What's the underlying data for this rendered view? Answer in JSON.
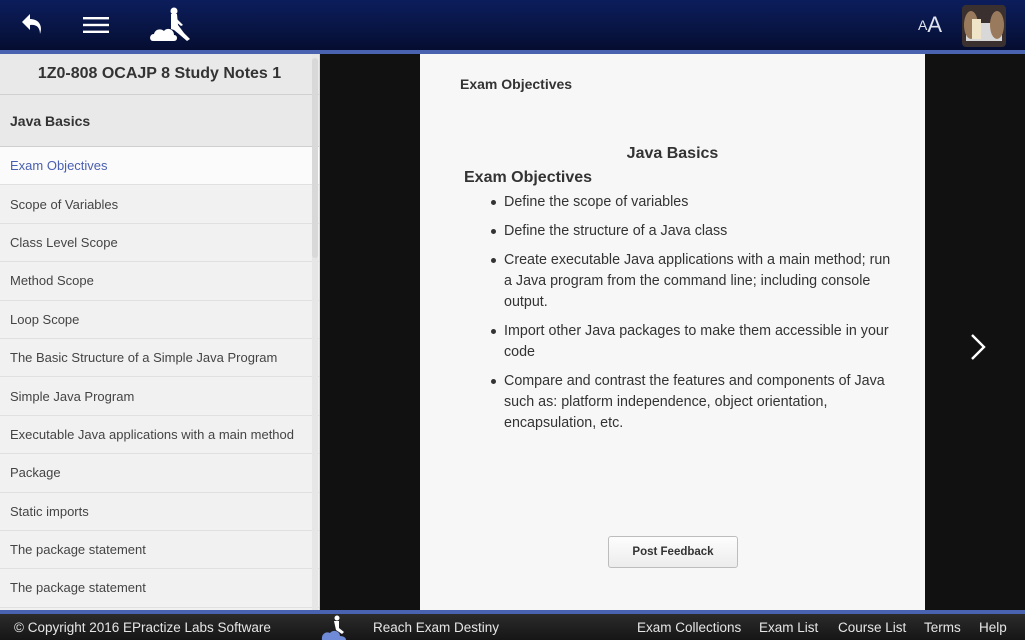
{
  "header": {
    "back_icon": "back-arrow-icon",
    "menu_icon": "hamburger-menu-icon",
    "logo_icon": "person-reading-on-cloud-logo",
    "font_size_small": "A",
    "font_size_large": "A",
    "avatar": "user-avatar-photo"
  },
  "sidebar": {
    "title": "1Z0-808 OCAJP 8 Study Notes 1",
    "section": "Java Basics",
    "items": [
      {
        "label": "Exam Objectives",
        "active": true
      },
      {
        "label": "Scope of Variables"
      },
      {
        "label": "Class Level Scope"
      },
      {
        "label": "Method Scope"
      },
      {
        "label": "Loop Scope"
      },
      {
        "label": "The Basic Structure of a Simple Java Program"
      },
      {
        "label": "Simple Java Program"
      },
      {
        "label": "Executable Java applications with a main method"
      },
      {
        "label": "Package"
      },
      {
        "label": "Static imports"
      },
      {
        "label": "The package statement"
      },
      {
        "label": "The package statement"
      }
    ]
  },
  "content": {
    "heading": "Exam Objectives",
    "doc_title": "Java Basics",
    "doc_subtitle": "Exam Objectives",
    "objectives": [
      "Define the scope of variables",
      "Define the structure of a Java class",
      "Create executable Java applications with a main method; run a Java program from the command line; including console output.",
      "Import other Java packages to make them accessible in your code",
      "Compare and contrast the features and components of Java such as: platform independence, object orientation, encapsulation, etc."
    ],
    "feedback_button": "Post Feedback",
    "next_icon": "chevron-right-icon"
  },
  "footer": {
    "copyright": "© Copyright 2016 EPractize Labs Software",
    "tagline": "Reach Exam Destiny",
    "links": [
      "Exam Collections",
      "Exam List",
      "Course List",
      "Terms",
      "Help"
    ]
  },
  "colors": {
    "header_bg": "#081545",
    "accent_border": "#4a63b0",
    "active_item_text": "#4a5fb0",
    "main_bg": "#111111",
    "content_bg": "#f7f7f7",
    "footer_bg": "#1f1f1f"
  }
}
